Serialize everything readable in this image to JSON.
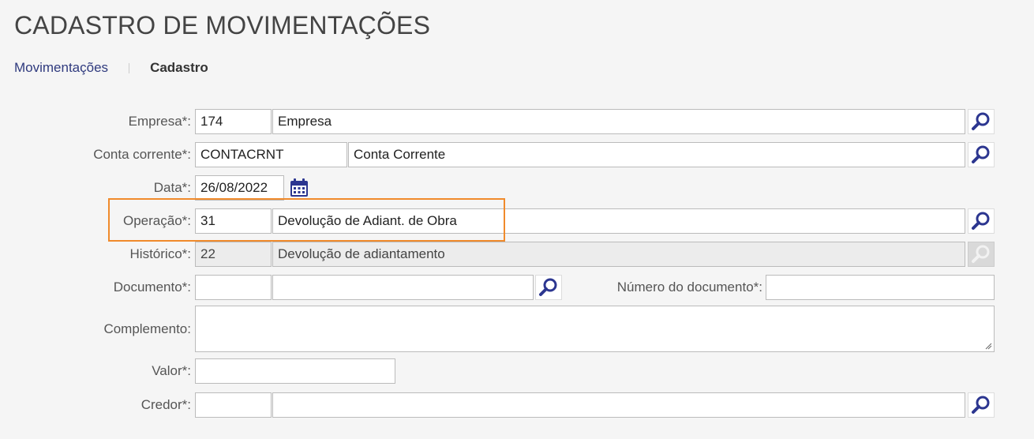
{
  "page": {
    "title": "CADASTRO DE MOVIMENTAÇÕES"
  },
  "breadcrumb": {
    "parent": "Movimentações",
    "current": "Cadastro"
  },
  "form": {
    "empresa": {
      "label": "Empresa*:",
      "code": "174",
      "name": "Empresa"
    },
    "conta_corrente": {
      "label": "Conta corrente*:",
      "code": "CONTACRNT",
      "name": "Conta Corrente"
    },
    "data": {
      "label": "Data*:",
      "value": "26/08/2022"
    },
    "operacao": {
      "label": "Operação*:",
      "code": "31",
      "name": "Devolução de Adiant. de Obra"
    },
    "historico": {
      "label": "Histórico*:",
      "code": "22",
      "name": "Devolução de adiantamento"
    },
    "documento": {
      "label": "Documento*:",
      "code": "",
      "name": ""
    },
    "numero_documento": {
      "label": "Número do documento*:",
      "value": ""
    },
    "complemento": {
      "label": "Complemento:",
      "value": ""
    },
    "valor": {
      "label": "Valor*:",
      "value": ""
    },
    "credor": {
      "label": "Credor*:",
      "code": "",
      "name": ""
    }
  },
  "colors": {
    "accent": "#2f3a7e",
    "highlight": "#f08a2b",
    "icon": "#2c3690"
  },
  "icons": {
    "search": "search-icon",
    "calendar": "calendar-icon"
  }
}
